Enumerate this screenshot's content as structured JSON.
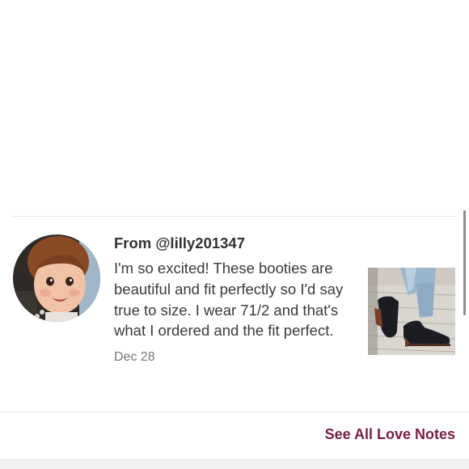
{
  "love_note": {
    "from_label": "From @lilly201347",
    "message": "I'm so excited! These booties are beautiful and fit perfectly so I'd say true to size. I wear 71/2 and that's what I ordered and the fit perfect.",
    "date": "Dec 28",
    "avatar_icon": "child-photo",
    "product_image_icon": "black-ankle-booties-photo"
  },
  "footer": {
    "see_all_label": "See All Love Notes",
    "link_color": "#7a1f3d"
  }
}
